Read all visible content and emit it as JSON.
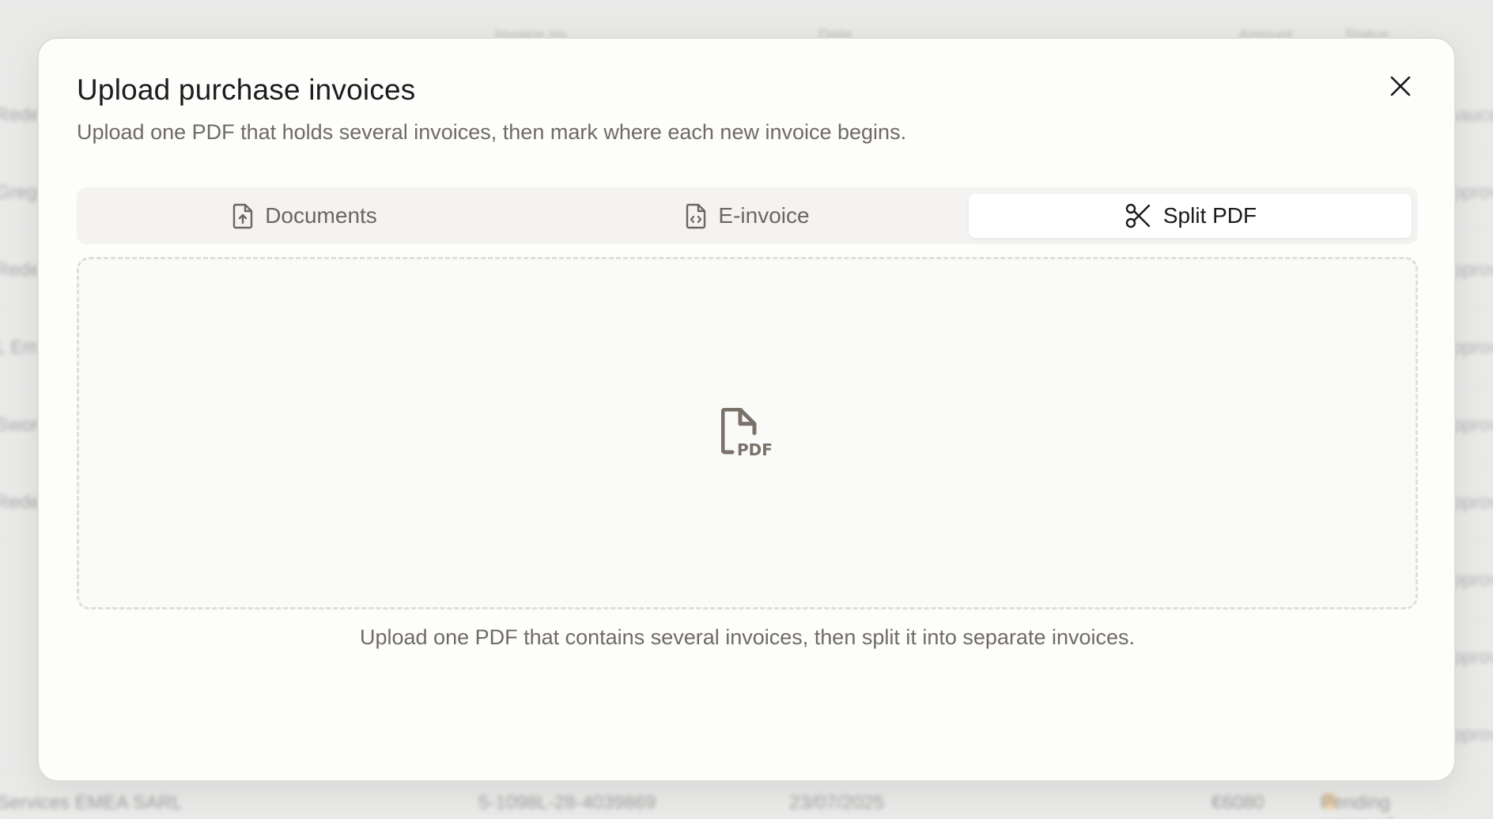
{
  "background": {
    "header": {
      "col1": "Invoice no.",
      "col2": "Date",
      "col3": "Amount",
      "col4": "Status"
    },
    "rows": [
      {
        "left": "Redes",
        "right": "sauce"
      },
      {
        "left": "Gregor",
        "right": "approv"
      },
      {
        "left": "Redes",
        "right": "approv"
      },
      {
        "left": "L Em",
        "right": "approv"
      },
      {
        "left": "Sword",
        "right": "approv"
      },
      {
        "left": "Redes",
        "right": "approv"
      },
      {
        "left": "",
        "right": "approv"
      },
      {
        "left": "",
        "right": "approv"
      },
      {
        "left": "",
        "right": "approv"
      }
    ],
    "bottom_row": {
      "vendor": "Services EMEA SARL",
      "invoice": "5-1098L-28-4039869",
      "date": "23/07/2025",
      "amount": "€6080",
      "status": "Pending approval"
    }
  },
  "dialog": {
    "title": "Upload purchase invoices",
    "subtitle": "Upload one PDF that holds several invoices, then mark where each new invoice begins.",
    "tabs": [
      {
        "label": "Documents",
        "icon": "file-upload-icon",
        "active": false
      },
      {
        "label": "E-invoice",
        "icon": "file-code-icon",
        "active": false
      },
      {
        "label": "Split PDF",
        "icon": "scissors-icon",
        "active": true
      }
    ],
    "dropzone_icon": "pdf-file-icon",
    "hint": "Upload one PDF that contains several invoices, then split it into separate invoices."
  },
  "colors": {
    "dialog_bg": "#fdfdfb",
    "tab_bar_bg": "#f4f3f1",
    "active_tab_bg": "#ffffff",
    "muted_text": "#6f6a66",
    "icon_color": "#7a716a"
  }
}
